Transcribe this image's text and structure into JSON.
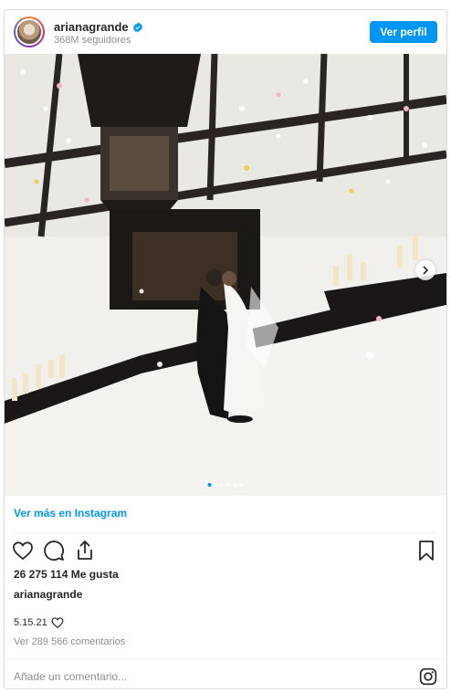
{
  "header": {
    "username": "arianagrande",
    "verified": true,
    "followers": "368M seguidores",
    "follow_button": "Ver perfil"
  },
  "post": {
    "image_alt": "",
    "carousel_total": 6,
    "carousel_active": 1,
    "more_link": "Ver más en Instagram",
    "likes": "26 275 114 Me gusta",
    "caption_user": "arianagrande",
    "date": "5.15.21",
    "comments_link": "Ver 289 566 comentarios",
    "comment_placeholder": "Añade un comentario..."
  },
  "colors": {
    "accent": "#0095f6",
    "text": "#262626",
    "muted": "#8e8e8e",
    "border": "#dbdbdb"
  },
  "icons": [
    "verified-badge-icon",
    "heart-icon",
    "comment-icon",
    "share-icon",
    "bookmark-icon",
    "chevron-right-icon",
    "instagram-logo-icon",
    "small-heart-icon"
  ]
}
